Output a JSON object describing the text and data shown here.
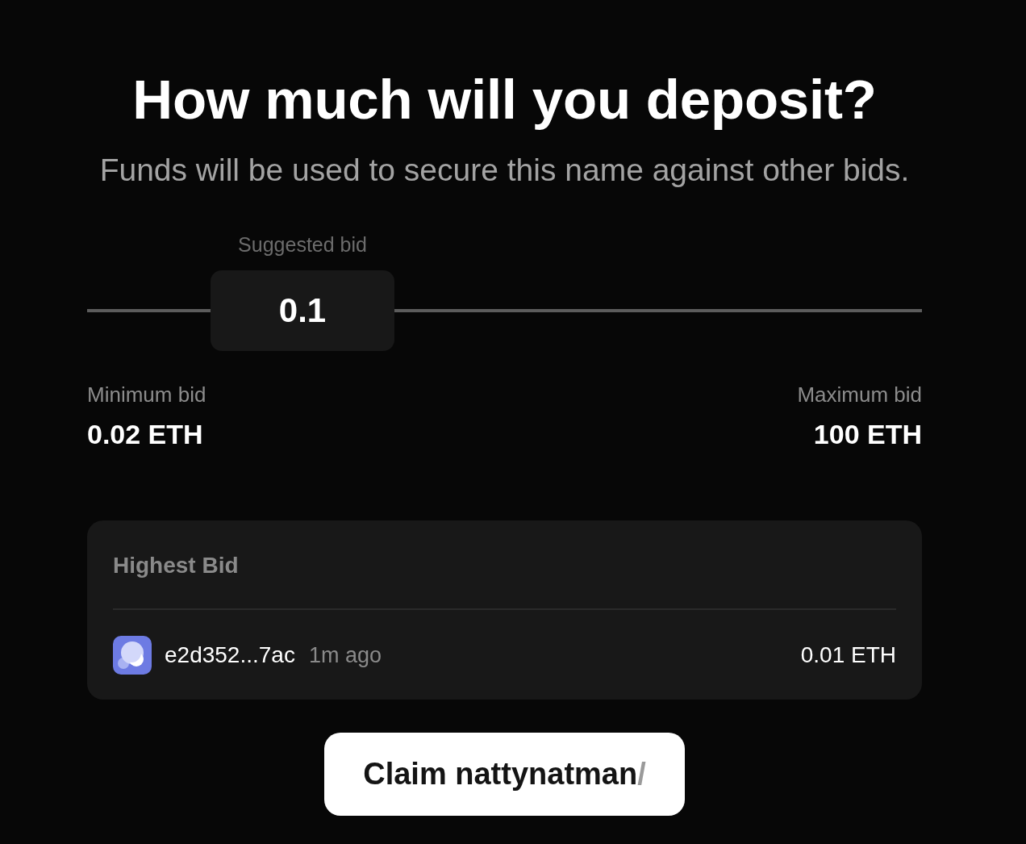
{
  "heading": {
    "title": "How much will you deposit?",
    "subtitle": "Funds will be used to secure this name against other bids."
  },
  "bid_slider": {
    "label": "Suggested bid",
    "value": "0.1",
    "level": 0.258
  },
  "range": [
    {
      "label": "Minimum bid",
      "value": "0.02 ETH"
    },
    {
      "label": "Maximum bid",
      "value": "100 ETH"
    }
  ],
  "highest_bid": {
    "title": "Highest Bid",
    "bids": [
      {
        "address": "e2d352...7ac",
        "time": "1m ago",
        "amount": "0.01 ETH"
      }
    ]
  },
  "claim_button": {
    "label": "Claim nattynatman",
    "suffix": "/"
  }
}
